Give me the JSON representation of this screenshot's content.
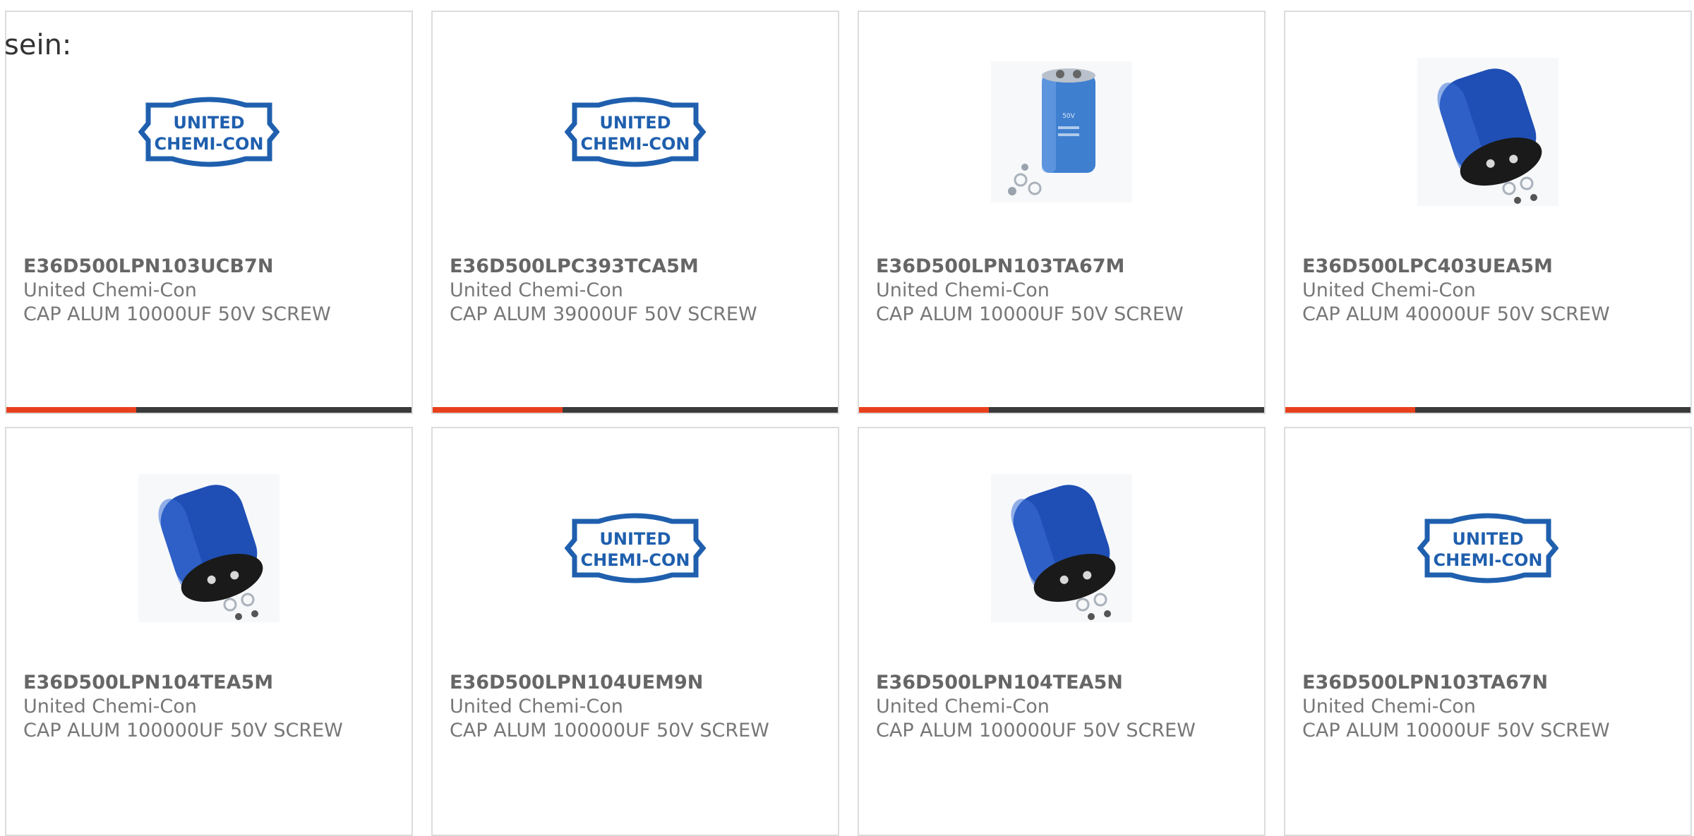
{
  "intro_text": "sein:",
  "accent_color": "#e8401c",
  "bar_color": "#3a3a3a",
  "logo": {
    "line1": "UNITED",
    "line2": "CHEMI-CON",
    "color": "#1f5fae"
  },
  "products": [
    {
      "part_number": "E36D500LPN103UCB7N",
      "manufacturer": "United Chemi-Con",
      "description": "CAP ALUM 10000UF 50V SCREW",
      "image": "united-chemi-con-logo",
      "accent_fraction": 0.32
    },
    {
      "part_number": "E36D500LPC393TCA5M",
      "manufacturer": "United Chemi-Con",
      "description": "CAP ALUM 39000UF 50V SCREW",
      "image": "united-chemi-con-logo",
      "accent_fraction": 0.32
    },
    {
      "part_number": "E36D500LPN103TA67M",
      "manufacturer": "United Chemi-Con",
      "description": "CAP ALUM 10000UF 50V SCREW",
      "image": "capacitor-upright-photo",
      "accent_fraction": 0.32
    },
    {
      "part_number": "E36D500LPC403UEA5M",
      "manufacturer": "United Chemi-Con",
      "description": "CAP ALUM 40000UF 50V SCREW",
      "image": "capacitor-tilted-photo",
      "accent_fraction": 0.32
    },
    {
      "part_number": "E36D500LPN104TEA5M",
      "manufacturer": "United Chemi-Con",
      "description": "CAP ALUM 100000UF 50V SCREW",
      "image": "capacitor-tilted-photo",
      "accent_fraction": 0
    },
    {
      "part_number": "E36D500LPN104UEM9N",
      "manufacturer": "United Chemi-Con",
      "description": "CAP ALUM 100000UF 50V SCREW",
      "image": "united-chemi-con-logo",
      "accent_fraction": 0
    },
    {
      "part_number": "E36D500LPN104TEA5N",
      "manufacturer": "United Chemi-Con",
      "description": "CAP ALUM 100000UF 50V SCREW",
      "image": "capacitor-tilted-photo",
      "accent_fraction": 0
    },
    {
      "part_number": "E36D500LPN103TA67N",
      "manufacturer": "United Chemi-Con",
      "description": "CAP ALUM 10000UF 50V SCREW",
      "image": "united-chemi-con-logo",
      "accent_fraction": 0
    }
  ]
}
